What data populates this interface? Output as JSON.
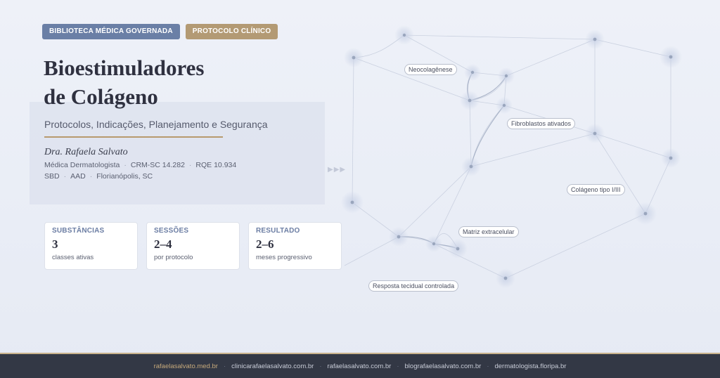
{
  "tags": {
    "library": "BIBLIOTECA MÉDICA GOVERNADA",
    "protocol": "PROTOCOLO CLÍNICO"
  },
  "title": {
    "line1": "Bioestimuladores",
    "line2": "de Colágeno"
  },
  "subtitle": "Protocolos, Indicações, Planejamento e Segurança",
  "author": {
    "name": "Dra. Rafaela Salvato",
    "specialty": "Médica Dermatologista",
    "crm": "CRM-SC 14.282",
    "rqe": "RQE 10.934",
    "sbd": "SBD",
    "aad": "AAD",
    "city": "Florianópolis, SC"
  },
  "arrows": "▶▶▶",
  "stats": [
    {
      "label": "SUBSTÂNCIAS",
      "value": "3",
      "unit": "classes ativas"
    },
    {
      "label": "SESSÕES",
      "value": "2–4",
      "unit": "por protocolo"
    },
    {
      "label": "RESULTADO",
      "value": "2–6",
      "unit": "meses progressivo"
    }
  ],
  "network_labels": {
    "neocolagenese": "Neocolagênese",
    "fibroblastos": "Fibroblastos ativados",
    "colageno": "Colágeno tipo I/III",
    "matriz": "Matriz extracelular",
    "resposta": "Resposta tecidual controlada"
  },
  "footer": {
    "links": [
      "rafaelasalvato.med.br",
      "clinicarafaelasalvato.com.br",
      "rafaelasalvato.com.br",
      "blografaelasalvato.com.br",
      "dermatologista.floripa.br"
    ],
    "separator": "·"
  },
  "colors": {
    "accent_blue": "#6a7fa6",
    "accent_gold": "#b39a74",
    "footer_bg": "#333845",
    "footer_link_primary": "#c6a97b"
  }
}
